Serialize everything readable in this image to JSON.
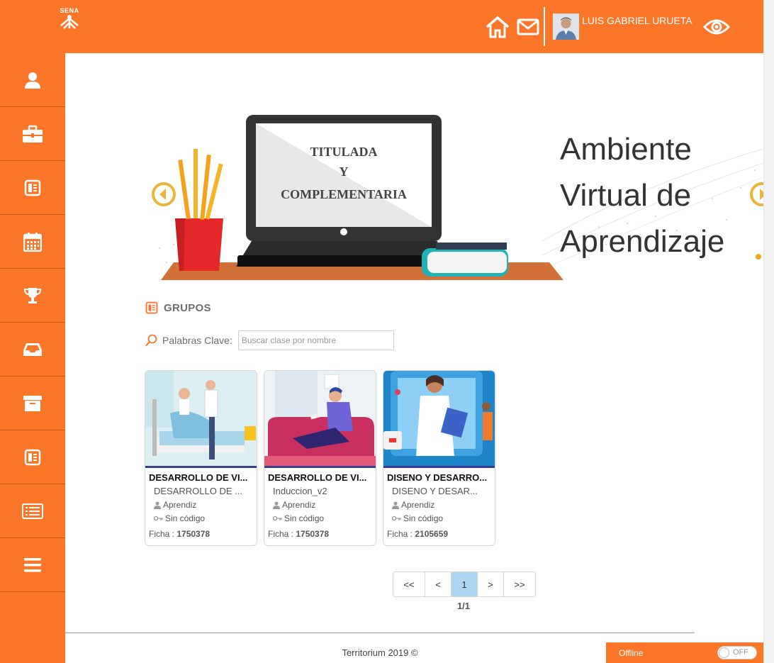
{
  "header": {
    "logo_text": "SENA",
    "username": "LUIS GABRIEL URUETA"
  },
  "sidebar": {
    "items": [
      {
        "icon": "user-icon"
      },
      {
        "icon": "briefcase-icon"
      },
      {
        "icon": "book-icon"
      },
      {
        "icon": "calendar-icon"
      },
      {
        "icon": "trophy-icon"
      },
      {
        "icon": "inbox-icon"
      },
      {
        "icon": "archive-icon"
      },
      {
        "icon": "book-icon"
      },
      {
        "icon": "list-icon"
      },
      {
        "icon": "menu-icon"
      }
    ]
  },
  "banner": {
    "screen_line1": "TITULADA",
    "screen_line2": "Y",
    "screen_line3": "COMPLEMENTARIA",
    "heading_line1": "Ambiente",
    "heading_line2": "Virtual de",
    "heading_line3": "Aprendizaje"
  },
  "section": {
    "title": "GRUPOS",
    "search_label": "Palabras Clave:",
    "search_placeholder": "Buscar clase por nombre"
  },
  "cards": [
    {
      "title": "DESARROLLO DE VI...",
      "subtitle": "DESARROLLO DE ...",
      "role": "Aprendiz",
      "code": "Sin código",
      "ficha_label": "Ficha :",
      "ficha": "1750378"
    },
    {
      "title": "DESARROLLO DE VI...",
      "subtitle": "Induccion_v2",
      "role": "Aprendiz",
      "code": "Sin código",
      "ficha_label": "Ficha :",
      "ficha": "1750378"
    },
    {
      "title": "DISENO Y DESARRO...",
      "subtitle": "DISENO Y DESAR...",
      "role": "Aprendiz",
      "code": "Sin código",
      "ficha_label": "Ficha :",
      "ficha": "2105659"
    }
  ],
  "pagination": {
    "first": "<<",
    "prev": "<",
    "current": "1",
    "next": ">",
    "last": ">>",
    "info": "1/1"
  },
  "footer": {
    "text": "Territorium 2019 ©"
  },
  "offline": {
    "label": "Offline",
    "toggle_text": "OFF"
  },
  "colors": {
    "brand": "#fb7628",
    "active_page": "#aed6f1"
  }
}
